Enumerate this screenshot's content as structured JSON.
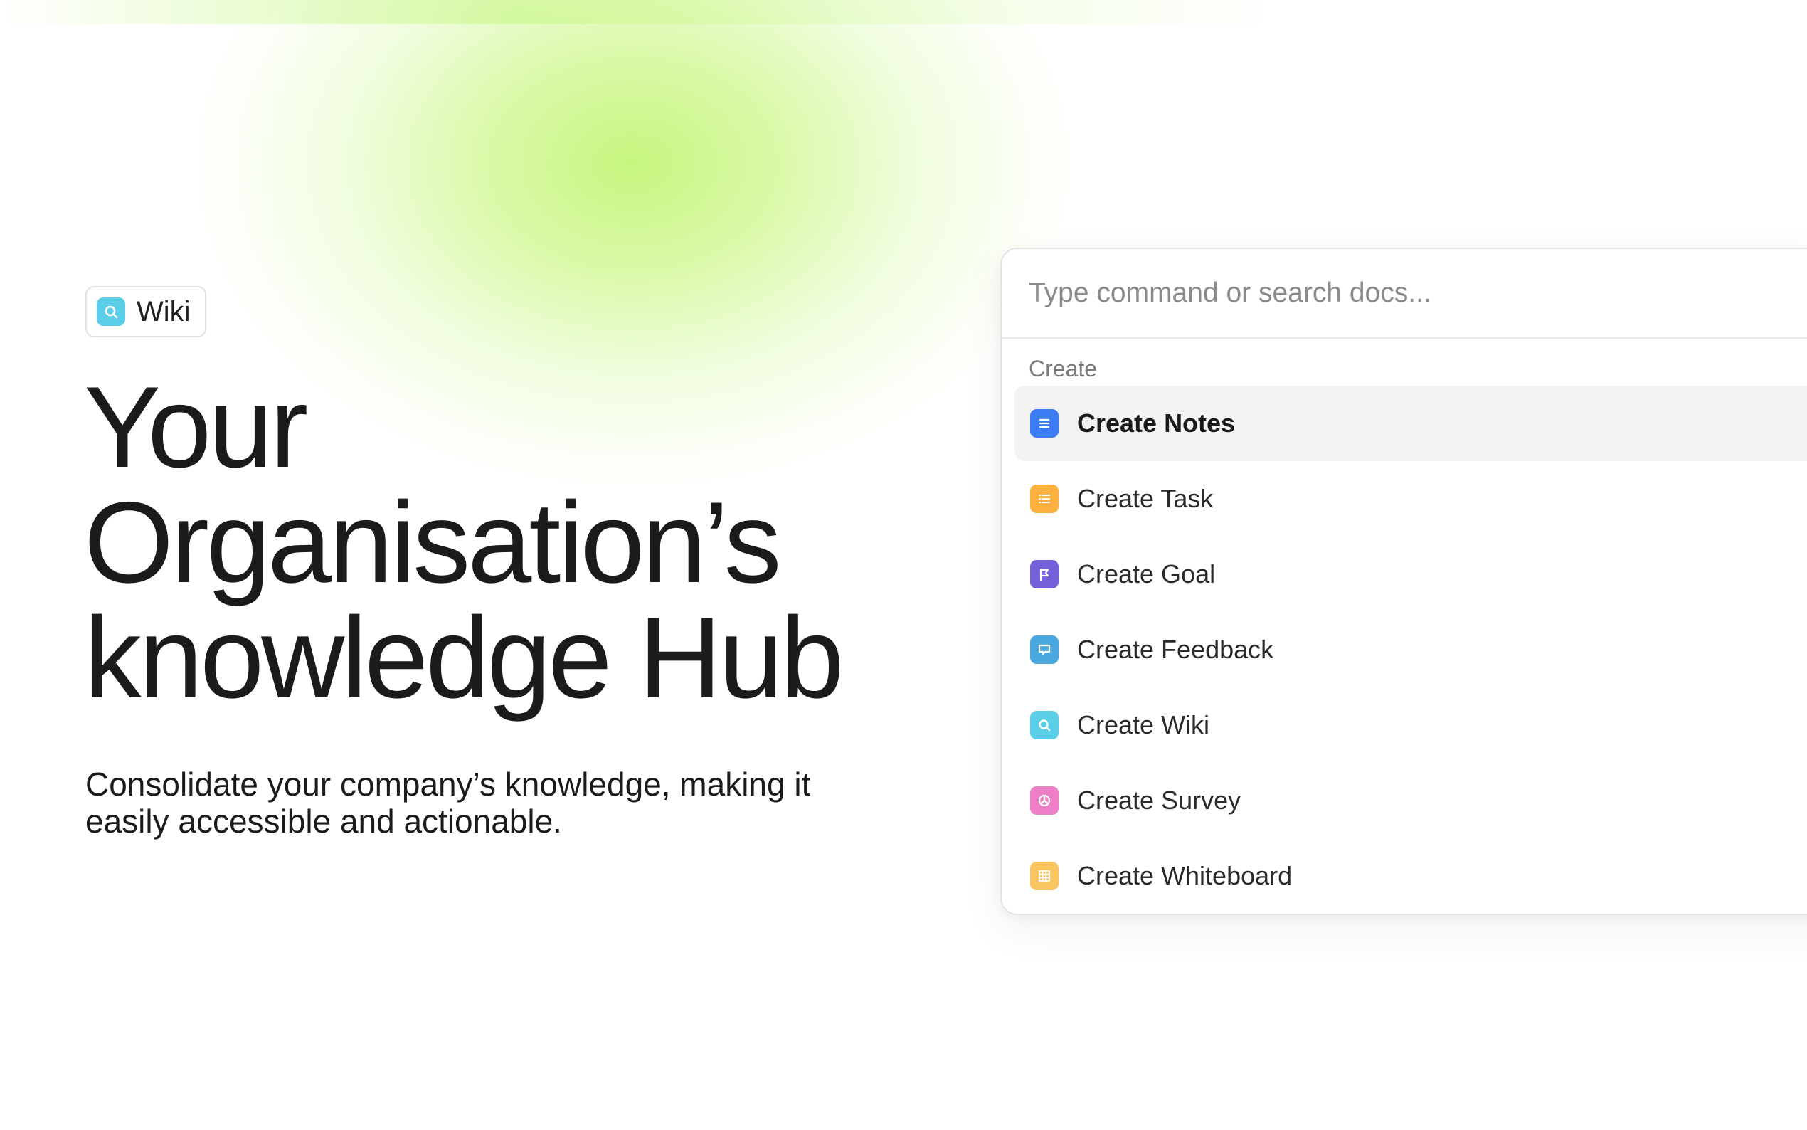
{
  "badge": {
    "label": "Wiki",
    "icon": "search-icon",
    "color": "#5ccfe8"
  },
  "hero": {
    "title_line1": "Your",
    "title_line2": "Organisation’s",
    "title_line3": "knowledge Hub",
    "subtitle_line1": "Consolidate your company’s knowledge, making it",
    "subtitle_line2": "easily accessible and actionable."
  },
  "palette": {
    "search_placeholder": "Type command or search docs...",
    "section_label": "Create",
    "items": [
      {
        "label": "Create Notes",
        "icon": "notes-icon",
        "color": "#3b7cf5",
        "active": true
      },
      {
        "label": "Create Task",
        "icon": "task-icon",
        "color": "#fbb040",
        "active": false
      },
      {
        "label": "Create Goal",
        "icon": "flag-icon",
        "color": "#7461d9",
        "active": false
      },
      {
        "label": "Create Feedback",
        "icon": "feedback-icon",
        "color": "#4aa8de",
        "active": false
      },
      {
        "label": "Create Wiki",
        "icon": "search-icon",
        "color": "#5ccfe8",
        "active": false
      },
      {
        "label": "Create Survey",
        "icon": "survey-icon",
        "color": "#ee7fc7",
        "active": false
      },
      {
        "label": "Create Whiteboard",
        "icon": "grid-icon",
        "color": "#f8c561",
        "active": false
      }
    ]
  }
}
